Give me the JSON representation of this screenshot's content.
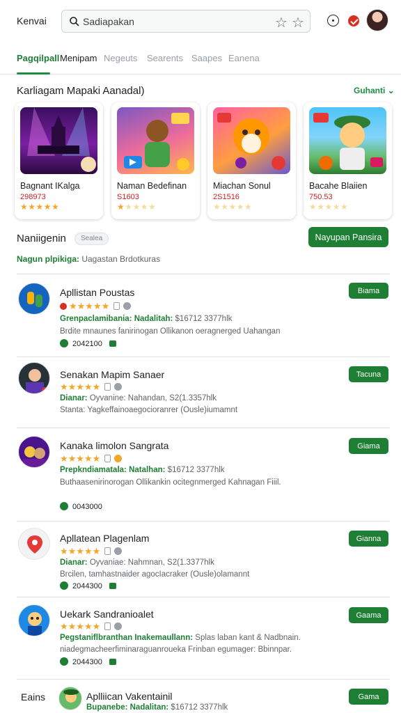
{
  "header": {
    "brand": "Kenvai",
    "search_value": "Sadiapakan",
    "search_placeholder": "Sadiapakan"
  },
  "tabs": [
    {
      "label": "Pagqilpall"
    },
    {
      "label": "Menipam"
    },
    {
      "label": "Negeuts"
    },
    {
      "label": "Searents"
    },
    {
      "label": "Saapes"
    },
    {
      "label": "Eanena"
    }
  ],
  "featured": {
    "title": "Karliagam Mapaki Aanadal)",
    "more_label": "Guhanti ⌄",
    "cards": [
      {
        "name": "Bagnant IKalga",
        "price": "298973",
        "rating": 5
      },
      {
        "name": "Naman Bedefinan",
        "price": "S1603",
        "rating": 1
      },
      {
        "name": "Miachan Sonul",
        "price": "2S1516",
        "rating": 0
      },
      {
        "name": "Bacahe Blaiien",
        "price": "750.53",
        "rating": 0
      }
    ]
  },
  "section2": {
    "title": "Naniigenin",
    "chip": "Sealea",
    "primary_button": "Nayupan Pansira",
    "subline_green": "Nagun plpikiga:",
    "subline_rest": "Uagastan Brdotkuras"
  },
  "apps": [
    {
      "title": "Apllistan Poustas",
      "meta_green": "Grenpaclamibania: Nadalitah:",
      "meta_rest": "$16712 3377hlk",
      "desc": "Brdite mnaunes fanirinogan Ollikanon oeragnerged Uahangan",
      "foot": "2042100",
      "button": "Biama"
    },
    {
      "title": "Senakan Mapim Sanaer",
      "meta_green": "Dianar:",
      "meta_rest": "Oyvanine: Nahandan, S2(1.3357hlk",
      "desc": "Stanta: Yagkeffainoaegocioranrer (Ousle)iumamnt",
      "foot": "",
      "button": "Tacuna"
    },
    {
      "title": "Kanaka limolon Sangrata",
      "meta_green": "Prepkndiamatala: Natalhan:",
      "meta_rest": "$16712 3377hlk",
      "desc": "Buthaasenirinorogan Ollikankin ocitegnmerged Kahnagan Fiiil.",
      "foot": "0043000",
      "button": "Giama"
    },
    {
      "title": "Apllatean Plagenlam",
      "meta_green": "Dianar:",
      "meta_rest": "Oyvaniae: Nahmnan, S2(1.3377hlk",
      "desc": "Brcilen, tamhastnaider agocIacraker (Ousle)olamannt",
      "foot": "2044300",
      "button": "Gianna"
    },
    {
      "title": "Uekark Sandranioalet",
      "meta_green": "Pegstaniflbranthan Inakemaullann:",
      "meta_rest": "Splas laban kant & Nadbnain.",
      "desc": "niadegmacheerfiminaraguanroueka Frinban egumager: Bbinnpar.",
      "foot": "2044300",
      "button": "Gaama"
    },
    {
      "title": "Aplliican Vakentainil",
      "meta_green": "Bupanebe: Nadalitan:",
      "meta_rest": "$16712 3377hlk",
      "desc": "",
      "foot": "",
      "button": "Gama"
    }
  ],
  "bottom_label": "Eains",
  "colors": {
    "accent_green": "#1e7e34",
    "star": "#f4a62a",
    "price_red": "#c5221f"
  }
}
